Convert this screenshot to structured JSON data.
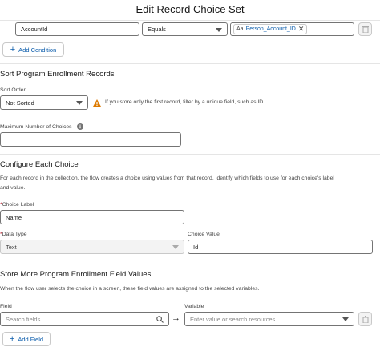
{
  "modal": {
    "title": "Edit Record Choice Set"
  },
  "filter_row": {
    "field_value": "AccountId",
    "operator_value": "Equals",
    "value_resource_icon": "Aa",
    "value_pill": "Person_Account_ID",
    "add_condition_label": "Add Condition"
  },
  "sort": {
    "section_title": "Sort Program Enrollment Records",
    "sort_order_label": "Sort Order",
    "sort_order_value": "Not Sorted",
    "warning_text": "If you store only the first record, filter by a unique field, such as ID.",
    "max_choices_label": "Maximum Number of Choices",
    "max_choices_value": ""
  },
  "configure": {
    "section_title": "Configure Each Choice",
    "description_line1": "For each record in the collection, the flow creates a choice using values from that record. Identify which fields to use for each choice's label",
    "description_line2": "and value.",
    "required_mark": "*",
    "choice_label_label": "Choice Label",
    "choice_label_value": "Name",
    "data_type_label": "Data Type",
    "data_type_value": "Text",
    "choice_value_label": "Choice Value",
    "choice_value_value": "Id"
  },
  "store": {
    "section_title": "Store More Program Enrollment Field Values",
    "description": "When the flow user selects the choice in a screen, these field values are assigned to the selected variables.",
    "field_label": "Field",
    "field_placeholder": "Search fields...",
    "arrow": "→",
    "variable_label": "Variable",
    "variable_placeholder": "Enter value or search resources...",
    "add_field_label": "Add Field"
  },
  "colors": {
    "link": "#0b5cab",
    "warning": "#dd7a01",
    "border": "#747474"
  }
}
